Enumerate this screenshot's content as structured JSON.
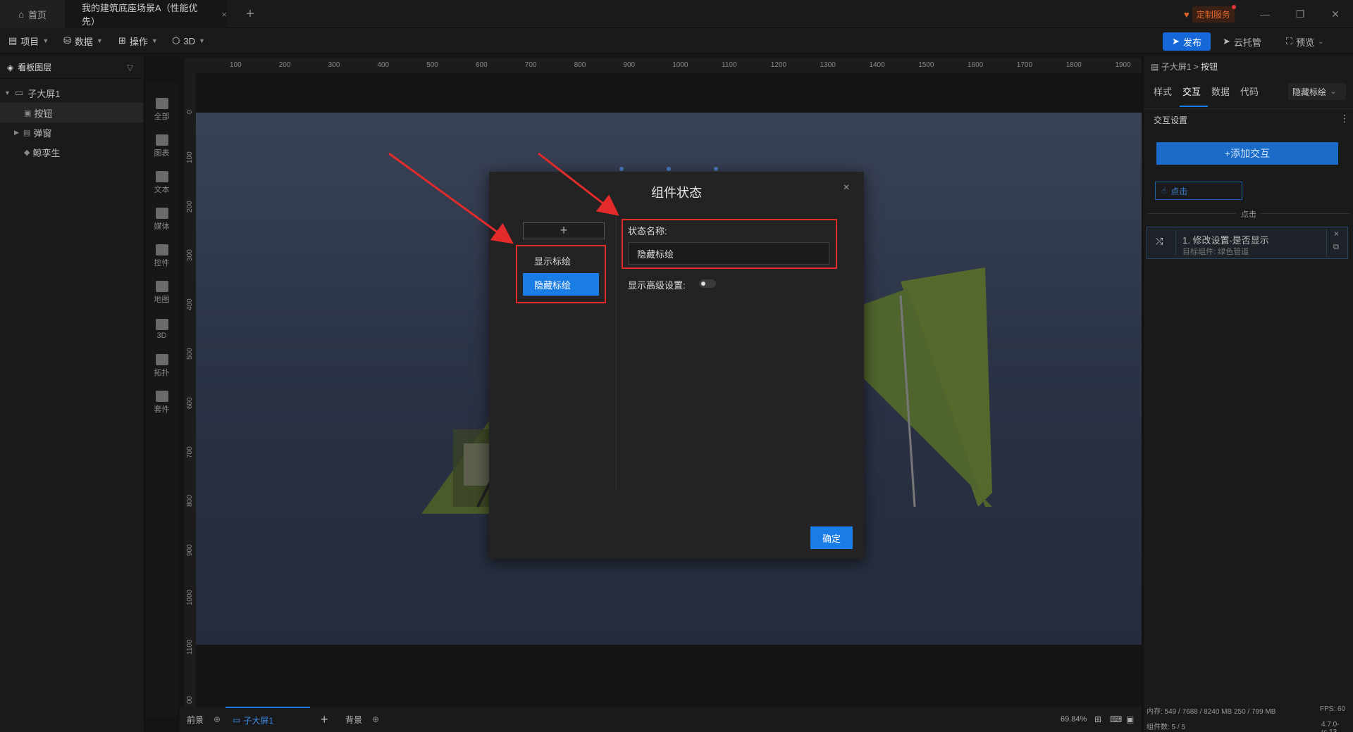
{
  "tabs": {
    "home": "首页",
    "scene": "我的建筑底座场景A（性能优先）",
    "close": "×",
    "add": "+"
  },
  "header": {
    "custom_service": "定制服务",
    "win_min": "—",
    "win_restore": "❐",
    "win_close": "✕"
  },
  "menu": {
    "project": "项目",
    "data": "数据",
    "operation": "操作",
    "threed": "3D",
    "publish": "发布",
    "cloud": "云托管",
    "preview": "预览"
  },
  "layers": {
    "title": "看板图层",
    "items": [
      {
        "label": "子大屏1"
      },
      {
        "label": "按钮"
      },
      {
        "label": "弹窗"
      },
      {
        "label": "鲸孪生"
      }
    ]
  },
  "palette": {
    "items": [
      {
        "label": "全部"
      },
      {
        "label": "图表"
      },
      {
        "label": "文本"
      },
      {
        "label": "媒体"
      },
      {
        "label": "控件"
      },
      {
        "label": "地图"
      },
      {
        "label": "3D"
      },
      {
        "label": "拓扑"
      },
      {
        "label": "套件"
      }
    ]
  },
  "ruler": {
    "top": [
      "100",
      "200",
      "300",
      "400",
      "500",
      "600",
      "700",
      "800",
      "900",
      "1000",
      "1100",
      "1200",
      "1300",
      "1400",
      "1500",
      "1600",
      "1700",
      "1800",
      "1900"
    ],
    "left": [
      "0",
      "100",
      "200",
      "300",
      "400",
      "500",
      "600",
      "700",
      "800",
      "900",
      "1000",
      "1100",
      "00"
    ]
  },
  "dialog": {
    "title": "组件状态",
    "add": "+",
    "states": [
      "显示标绘",
      "隐藏标绘"
    ],
    "active_state_index": 1,
    "state_name_label": "状态名称:",
    "state_name_value": "隐藏标绘",
    "advanced_label": "显示高级设置:",
    "advanced_enabled": false,
    "confirm": "确定",
    "close": "×"
  },
  "bottom": {
    "foreground": "前景",
    "screen": "子大屏1",
    "add": "+",
    "background": "背景",
    "zoom": "69.84%"
  },
  "right_panel": {
    "breadcrumb_parent": "子大屏1",
    "breadcrumb_sep": ">",
    "breadcrumb_current": "按钮",
    "tabs": [
      "样式",
      "交互",
      "数据",
      "代码"
    ],
    "active_tab_index": 1,
    "state_select": "隐藏标绘",
    "section_title": "交互设置",
    "add_interaction": "+添加交互",
    "trigger": "点击",
    "divider_text": "点击",
    "action_title": "1. 修改设置-是否显示",
    "action_sub": "目标组件: 绿色管道",
    "stats": "内存: 549 / 7688 / 8240 MB  250 / 799 MB",
    "fps": "FPS:  60",
    "component_count": "组件数: 5 / 5",
    "version": "4.7.0-rc.13"
  },
  "colors": {
    "accent": "#1a7de6",
    "annotation": "#e32b2b",
    "background": "#141414"
  }
}
